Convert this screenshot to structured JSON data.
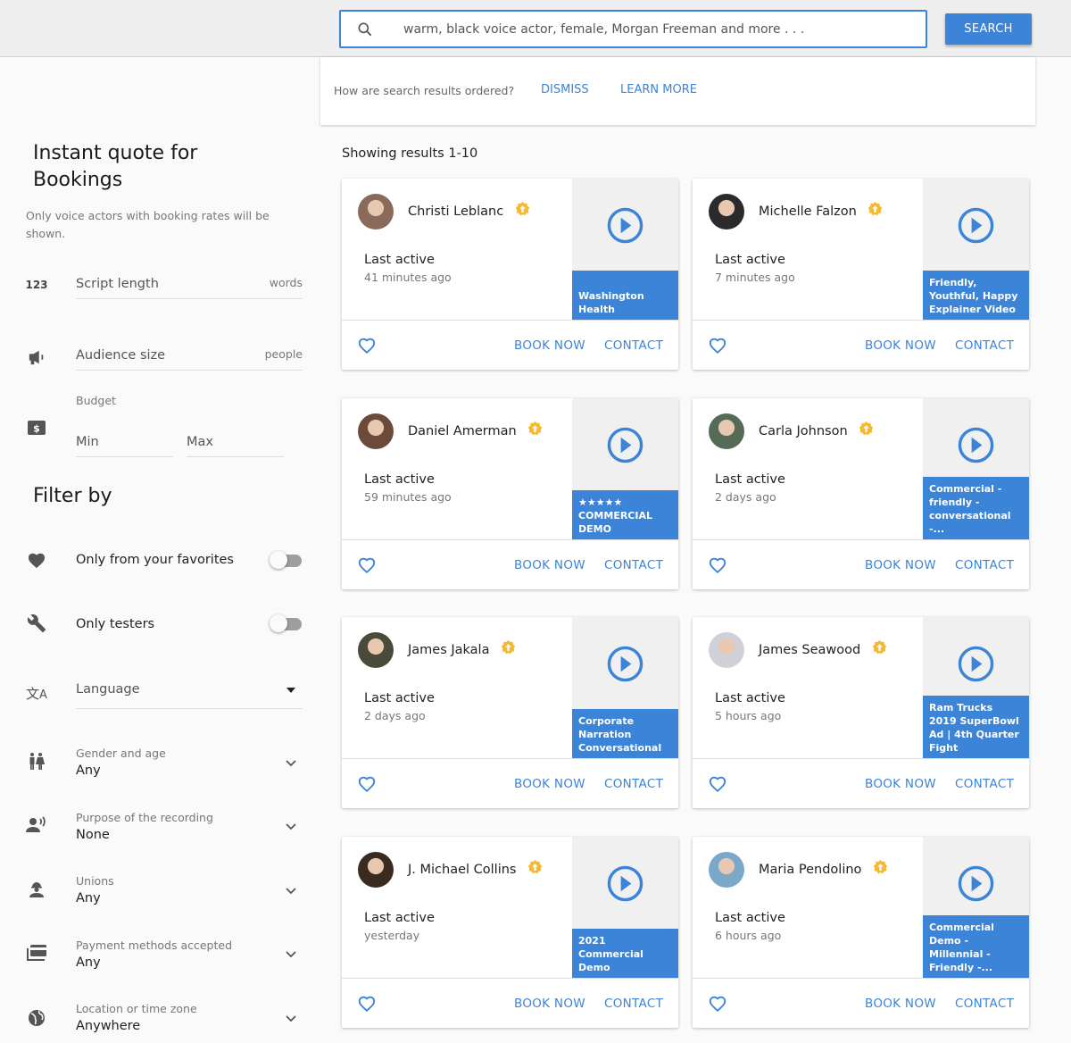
{
  "search": {
    "placeholder": "warm, black voice actor, female, Morgan Freeman and more . . .",
    "button_label": "SEARCH"
  },
  "order_banner": {
    "question": "How are search results ordered?",
    "dismiss_label": "DISMISS",
    "learn_more_label": "LEARN MORE"
  },
  "sidebar": {
    "quote_title_line1": "Instant quote for",
    "quote_title_line2": "Bookings",
    "quote_note": "Only voice actors with booking rates will be shown.",
    "script_length": {
      "placeholder": "Script length",
      "unit": "words",
      "icon": "numbers-icon"
    },
    "audience_size": {
      "placeholder": "Audience size",
      "unit": "people",
      "icon": "megaphone-icon"
    },
    "budget": {
      "label": "Budget",
      "min_placeholder": "Min",
      "max_placeholder": "Max",
      "icon": "dollar-icon"
    },
    "filter_title": "Filter by",
    "toggles": [
      {
        "label": "Only from your favorites",
        "icon": "heart-icon",
        "checked": false
      },
      {
        "label": "Only testers",
        "icon": "wrench-icon",
        "checked": false
      }
    ],
    "language": {
      "placeholder": "Language",
      "icon": "translate-icon"
    },
    "selects": [
      {
        "label": "Gender and age",
        "value": "Any",
        "icon": "wc-icon"
      },
      {
        "label": "Purpose of the recording",
        "value": "None",
        "icon": "record-voice-icon"
      },
      {
        "label": "Unions",
        "value": "Any",
        "icon": "engineer-icon"
      },
      {
        "label": "Payment methods accepted",
        "value": "Any",
        "icon": "payments-icon"
      },
      {
        "label": "Location or time zone",
        "value": "Anywhere",
        "icon": "globe-icon"
      }
    ]
  },
  "results": {
    "label": "Showing results 1-10",
    "last_active_label": "Last active",
    "book_label": "BOOK NOW",
    "contact_label": "CONTACT",
    "cards": [
      {
        "name": "Christi Leblanc",
        "ago": "41 minutes ago",
        "demo": "Washington Health",
        "avatar_color": "#8a6a5a"
      },
      {
        "name": "Michelle Falzon",
        "ago": "7 minutes ago",
        "demo": "Friendly, Youthful, Happy Explainer Video",
        "avatar_color": "#2b2b2b"
      },
      {
        "name": "Daniel Amerman",
        "ago": "59 minutes ago",
        "demo": "★★★★★ COMMERCIAL DEMO",
        "avatar_color": "#6b4a3a"
      },
      {
        "name": "Carla Johnson",
        "ago": "2 days ago",
        "demo": "Commercial - friendly - conversational -...",
        "avatar_color": "#556b55"
      },
      {
        "name": "James Jakala",
        "ago": "2 days ago",
        "demo": "Corporate Narration Conversational",
        "avatar_color": "#4a4a3a"
      },
      {
        "name": "James Seawood",
        "ago": "5 hours ago",
        "demo": "Ram Trucks 2019 SuperBowl Ad | 4th Quarter Fight",
        "avatar_color": "#d0d0d8"
      },
      {
        "name": "J. Michael Collins",
        "ago": "yesterday",
        "demo": "2021 Commercial Demo",
        "avatar_color": "#3a2a20"
      },
      {
        "name": "Maria Pendolino",
        "ago": "6 hours ago",
        "demo": "Commercial Demo - Millennial - Friendly -...",
        "avatar_color": "#7aa8c8"
      }
    ]
  },
  "colors": {
    "accent": "#3c84d8",
    "badge": "#f5b82e"
  }
}
